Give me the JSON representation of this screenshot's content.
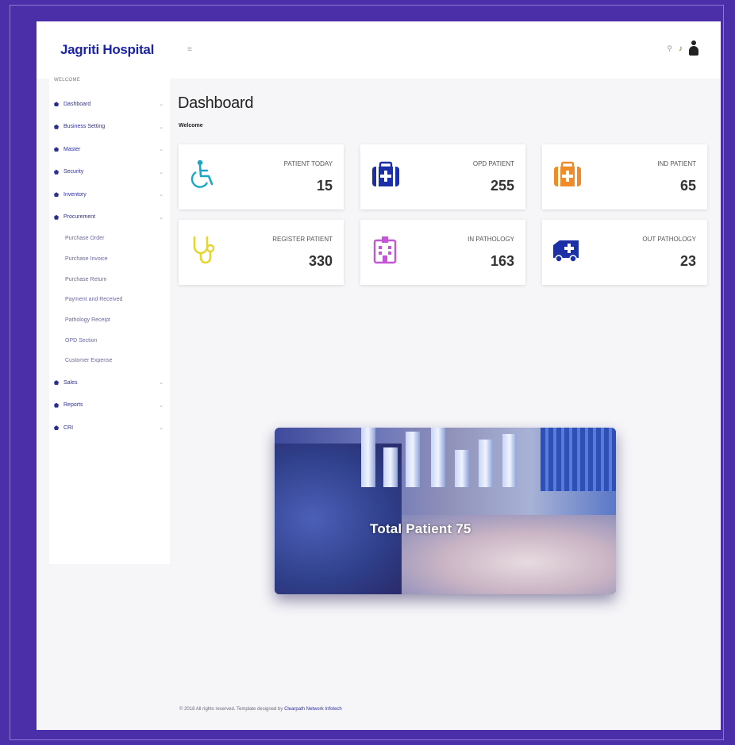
{
  "app": {
    "brand": "Jagriti Hospital",
    "hamburger_icon": "menu-icon",
    "icons": {
      "search": "search-icon",
      "bell": "bell-icon",
      "user": "user-icon"
    }
  },
  "sidebar": {
    "welcome": "WELCOME",
    "items": [
      {
        "label": "Dashboard",
        "icon": "home-icon"
      },
      {
        "label": "Business Setting",
        "icon": "home-icon"
      },
      {
        "label": "Master",
        "icon": "home-icon"
      },
      {
        "label": "Security",
        "icon": "home-icon"
      },
      {
        "label": "Inventory",
        "icon": "home-icon"
      },
      {
        "label": "Procurement",
        "icon": "home-icon"
      }
    ],
    "procurement_sub": [
      "Purchase Order",
      "Purchase Invoice",
      "Purchase Return",
      "Payment and Received",
      "Pathology Receipt",
      "OPD Section",
      "Customer Expense"
    ],
    "items_after": [
      {
        "label": "Sales",
        "icon": "home-icon"
      },
      {
        "label": "Reports",
        "icon": "home-icon"
      },
      {
        "label": "CRI",
        "icon": "home-icon"
      }
    ]
  },
  "main": {
    "title": "Dashboard",
    "subtitle": "Welcome"
  },
  "cards": [
    {
      "label": "PATIENT TODAY",
      "value": "15",
      "icon": "wheelchair-icon",
      "color": "#1aa7c4"
    },
    {
      "label": "OPD PATIENT",
      "value": "255",
      "icon": "medical-kit-icon",
      "color": "#1b2fa6"
    },
    {
      "label": "IND PATIENT",
      "value": "65",
      "icon": "medical-kit-icon",
      "color": "#f08b2a"
    },
    {
      "label": "REGISTER PATIENT",
      "value": "330",
      "icon": "stethoscope-icon",
      "color": "#e6d531"
    },
    {
      "label": "IN PATHOLOGY",
      "value": "163",
      "icon": "hospital-building-icon",
      "color": "#c455d8"
    },
    {
      "label": "OUT PATHOLOGY",
      "value": "23",
      "icon": "ambulance-icon",
      "color": "#1b2fa6"
    }
  ],
  "hero": {
    "caption": "Total Patient 75"
  },
  "footer": {
    "text": "© 2018 All rights reserved. Template designed by",
    "credit": "Clearpath Network Infotech"
  }
}
